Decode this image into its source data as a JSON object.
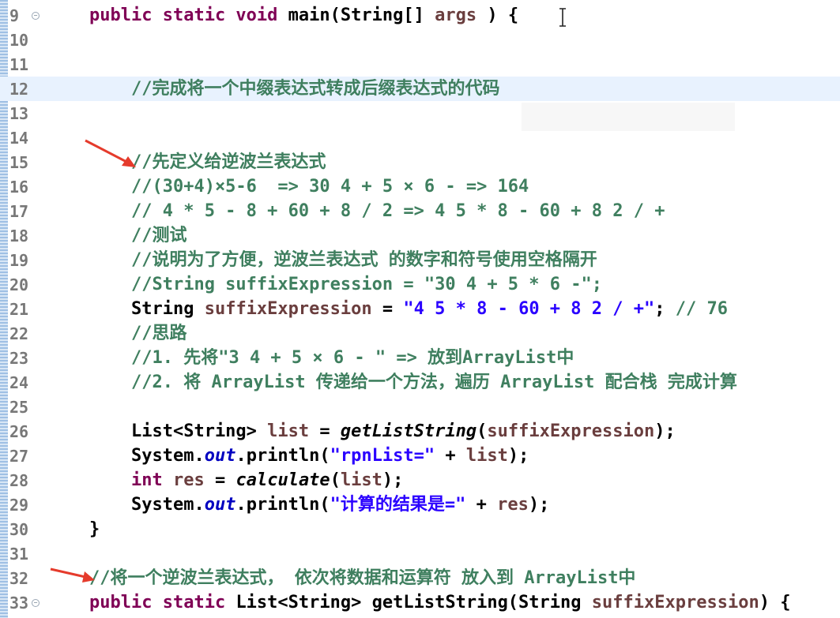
{
  "editor": {
    "language": "java",
    "lines": [
      {
        "n": "9",
        "fold": true,
        "segs": [
          [
            "kw",
            "public static void "
          ],
          [
            "",
            "main(String[] "
          ],
          [
            "var",
            "args"
          ],
          [
            "",
            " ) {"
          ]
        ]
      },
      {
        "n": "10",
        "segs": []
      },
      {
        "n": "11",
        "segs": []
      },
      {
        "n": "12",
        "current": true,
        "segs": [
          [
            "cm",
            "    //完成将一个中缀表达式转成后缀表达式的代码"
          ]
        ]
      },
      {
        "n": "13",
        "segs": []
      },
      {
        "n": "14",
        "segs": []
      },
      {
        "n": "15",
        "segs": [
          [
            "cm",
            "    //先定义给逆波兰表达式"
          ]
        ]
      },
      {
        "n": "16",
        "segs": [
          [
            "cm",
            "    //(30+4)×5-6  => 30 4 + 5 × 6 - => 164"
          ]
        ]
      },
      {
        "n": "17",
        "segs": [
          [
            "cm",
            "    // 4 * 5 - 8 + 60 + 8 / 2 => 4 5 * 8 - 60 + 8 2 / +"
          ]
        ]
      },
      {
        "n": "18",
        "segs": [
          [
            "cm",
            "    //测试"
          ]
        ]
      },
      {
        "n": "19",
        "segs": [
          [
            "cm",
            "    //说明为了方便，逆波兰表达式 的数字和符号使用空格隔开"
          ]
        ]
      },
      {
        "n": "20",
        "segs": [
          [
            "cm",
            "    //String suffixExpression = \"30 4 + 5 * 6 -\";"
          ]
        ]
      },
      {
        "n": "21",
        "segs": [
          [
            "",
            "    String "
          ],
          [
            "var",
            "suffixExpression"
          ],
          [
            "",
            " = "
          ],
          [
            "str",
            "\"4 5 * 8 - 60 + 8 2 / +\""
          ],
          [
            "",
            ";"
          ],
          [
            "cm",
            " // 76"
          ]
        ]
      },
      {
        "n": "22",
        "segs": [
          [
            "cm",
            "    //思路"
          ]
        ]
      },
      {
        "n": "23",
        "segs": [
          [
            "cm",
            "    //1. 先将\"3 4 + 5 × 6 - \" => 放到ArrayList中"
          ]
        ]
      },
      {
        "n": "24",
        "segs": [
          [
            "cm",
            "    //2. 将 ArrayList 传递给一个方法，遍历 ArrayList 配合栈 完成计算"
          ]
        ]
      },
      {
        "n": "25",
        "segs": []
      },
      {
        "n": "26",
        "segs": [
          [
            "",
            "    List<String> "
          ],
          [
            "var",
            "list"
          ],
          [
            "",
            " = "
          ],
          [
            "it",
            "getListString"
          ],
          [
            "",
            "("
          ],
          [
            "var",
            "suffixExpression"
          ],
          [
            "",
            ");"
          ]
        ]
      },
      {
        "n": "27",
        "segs": [
          [
            "",
            "    System."
          ],
          [
            "fld",
            "out"
          ],
          [
            "",
            ".println("
          ],
          [
            "str",
            "\"rpnList=\""
          ],
          [
            "",
            " + "
          ],
          [
            "var",
            "list"
          ],
          [
            "",
            ");"
          ]
        ]
      },
      {
        "n": "28",
        "segs": [
          [
            "kw",
            "    int "
          ],
          [
            "var",
            "res"
          ],
          [
            "",
            " = "
          ],
          [
            "it",
            "calculate"
          ],
          [
            "",
            "("
          ],
          [
            "var",
            "list"
          ],
          [
            "",
            ");"
          ]
        ]
      },
      {
        "n": "29",
        "segs": [
          [
            "",
            "    System."
          ],
          [
            "fld",
            "out"
          ],
          [
            "",
            ".println("
          ],
          [
            "str",
            "\"计算的结果是=\""
          ],
          [
            "",
            " + "
          ],
          [
            "var",
            "res"
          ],
          [
            "",
            ");"
          ]
        ]
      },
      {
        "n": "30",
        "segs": [
          [
            "",
            "}"
          ]
        ]
      },
      {
        "n": "31",
        "segs": []
      },
      {
        "n": "32",
        "segs": [
          [
            "cm",
            "//将一个逆波兰表达式， 依次将数据和运算符 放入到 ArrayList中"
          ]
        ]
      },
      {
        "n": "33",
        "fold": true,
        "segs": [
          [
            "kw",
            "public static "
          ],
          [
            "",
            "List<String> getListString(String "
          ],
          [
            "var",
            "suffixExpression"
          ],
          [
            "",
            ") {"
          ]
        ]
      }
    ]
  },
  "colors": {
    "comment": "#3f7f5f",
    "keyword": "#7f0055",
    "string": "#2a00ff",
    "field": "#0000c0",
    "annotation_arrow": "#e53b2c"
  }
}
